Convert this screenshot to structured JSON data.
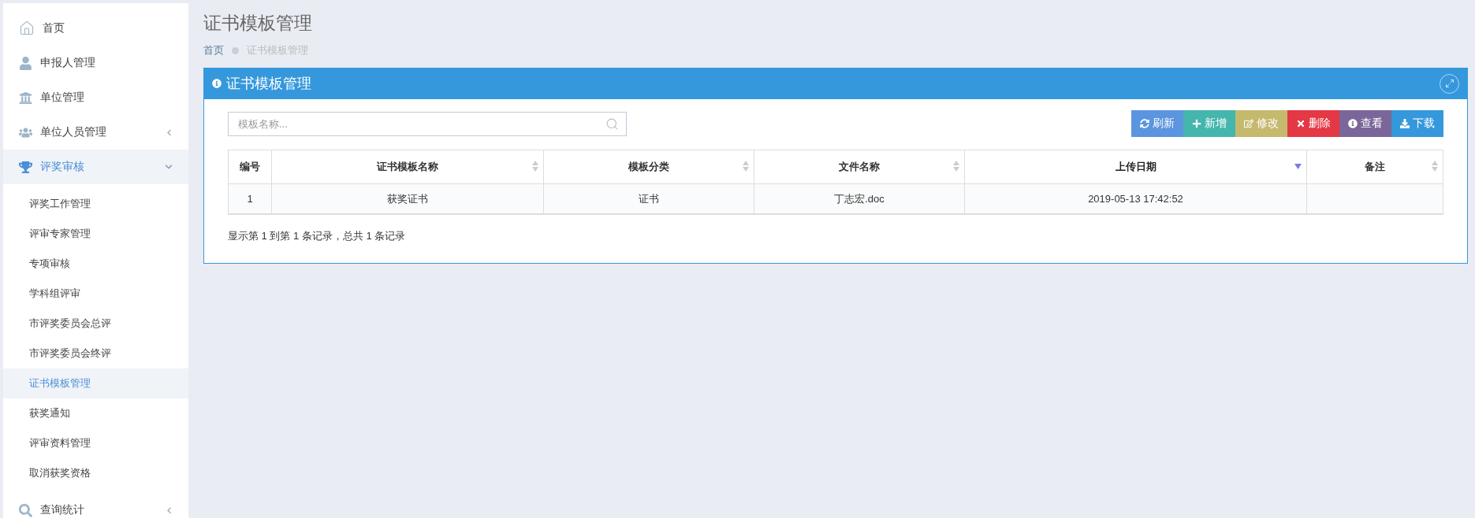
{
  "sidebar": {
    "items": [
      {
        "label": "首页",
        "selected": false
      },
      {
        "label": "申报人管理",
        "selected": false
      },
      {
        "label": "单位管理",
        "selected": false
      },
      {
        "label": "单位人员管理",
        "selected": false,
        "expanded": false
      },
      {
        "label": "评奖审核",
        "selected": true,
        "expanded": true,
        "children": [
          {
            "label": "评奖工作管理",
            "selected": false
          },
          {
            "label": "评审专家管理",
            "selected": false
          },
          {
            "label": "专项审核",
            "selected": false
          },
          {
            "label": "学科组评审",
            "selected": false
          },
          {
            "label": "市评奖委员会总评",
            "selected": false
          },
          {
            "label": "市评奖委员会终评",
            "selected": false
          },
          {
            "label": "证书模板管理",
            "selected": true
          },
          {
            "label": "获奖通知",
            "selected": false
          },
          {
            "label": "评审资料管理",
            "selected": false
          },
          {
            "label": "取消获奖资格",
            "selected": false
          }
        ]
      },
      {
        "label": "查询统计",
        "selected": false,
        "expanded": false
      }
    ]
  },
  "page": {
    "title": "证书模板管理",
    "breadcrumb": [
      "首页",
      "证书模板管理"
    ]
  },
  "panel": {
    "title": "证书模板管理",
    "search": {
      "placeholder": "模板名称..."
    },
    "buttons": [
      {
        "label": "刷新",
        "color": "#5b95df"
      },
      {
        "label": "新增",
        "color": "#45b6ad"
      },
      {
        "label": "修改",
        "color": "#c5b96d"
      },
      {
        "label": "删除",
        "color": "#e43844"
      },
      {
        "label": "查看",
        "color": "#7a6699"
      },
      {
        "label": "下载",
        "color": "#3598dc"
      }
    ],
    "table": {
      "columns": [
        {
          "label": "编号",
          "sortable": false,
          "sorted": false
        },
        {
          "label": "证书模板名称",
          "sortable": true,
          "sorted": false
        },
        {
          "label": "模板分类",
          "sortable": true,
          "sorted": false
        },
        {
          "label": "文件名称",
          "sortable": true,
          "sorted": false
        },
        {
          "label": "上传日期",
          "sortable": true,
          "sorted": true
        },
        {
          "label": "备注",
          "sortable": true,
          "sorted": false
        }
      ],
      "rows": [
        [
          "1",
          "获奖证书",
          "证书",
          "丁志宏.doc",
          "2019-05-13 17:42:52",
          ""
        ]
      ]
    },
    "footer": "显示第 1 到第 1 条记录，总共 1 条记录"
  }
}
